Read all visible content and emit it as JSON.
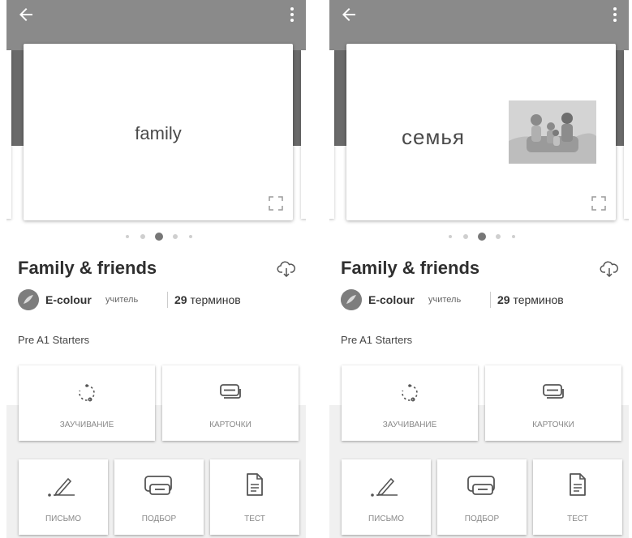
{
  "panels": [
    {
      "card_text": "family",
      "set_title": "Family & friends",
      "author": {
        "name": "E-colour",
        "role": "учитель",
        "term_count": "29",
        "term_word": "терминов"
      },
      "description": "Pre A1 Starters",
      "modes": {
        "learn": "ЗАУЧИВАНИЕ",
        "cards": "КАРТОЧКИ",
        "write": "ПИСЬМО",
        "match": "ПОДБОР",
        "test": "ТЕСТ"
      },
      "has_image": false
    },
    {
      "card_text": "семья",
      "set_title": "Family & friends",
      "author": {
        "name": "E-colour",
        "role": "учитель",
        "term_count": "29",
        "term_word": "терминов"
      },
      "description": "Pre A1 Starters",
      "modes": {
        "learn": "ЗАУЧИВАНИЕ",
        "cards": "КАРТОЧКИ",
        "write": "ПИСЬМО",
        "match": "ПОДБОР",
        "test": "ТЕСТ"
      },
      "has_image": true
    }
  ],
  "pager": {
    "count": 5,
    "active_index": 2
  },
  "icons": {
    "back": "arrow-back-icon",
    "more": "more-vert-icon",
    "expand": "expand-icon",
    "download": "cloud-download-icon",
    "learn": "learn-cycle-icon",
    "cards": "flashcards-icon",
    "write": "write-pen-icon",
    "match": "match-icon",
    "test": "test-document-icon"
  },
  "colors": {
    "appbar": "#6a6a6a",
    "appbar_top": "#8a8a8a",
    "modes_background": "#f0f0f0"
  }
}
